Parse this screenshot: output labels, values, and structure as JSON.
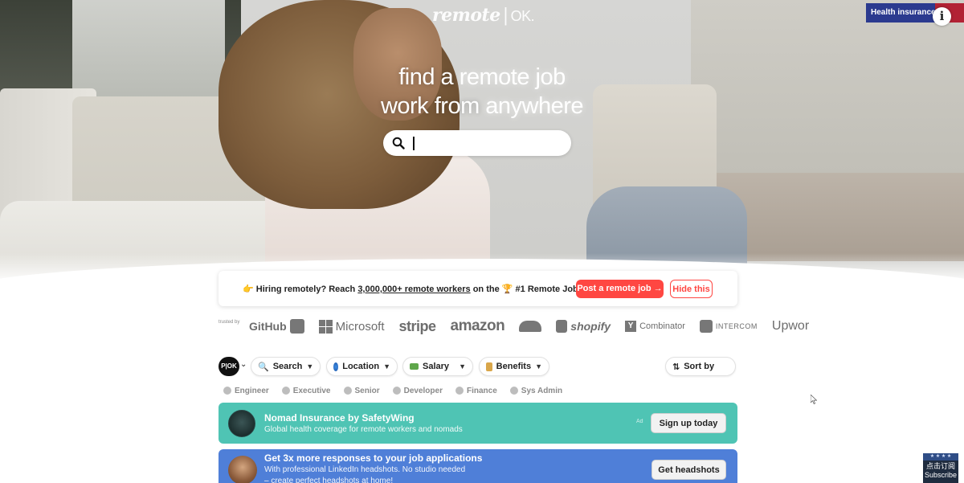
{
  "header": {
    "logo_main": "remote",
    "logo_sep": "|",
    "logo_ok": "OK.",
    "promo_badge": "Health insurance",
    "info_icon": "info-icon"
  },
  "hero": {
    "line1_a": "find a ",
    "line1_b": "remote job",
    "line2_a": "work from ",
    "line2_b": "anywhere",
    "search_value": "",
    "search_icon": "search-icon"
  },
  "hiring_banner": {
    "emoji": "👉",
    "text_before": "Hiring remotely? Reach ",
    "text_link": "3,000,000+ remote workers",
    "text_middle": " on the ",
    "trophy": "🏆",
    "text_after": " #1 Remote Job Board",
    "post_button": "Post a remote job →",
    "hide_button": "Hide this"
  },
  "trusted": {
    "label": "trusted by",
    "brands": [
      "GitHub",
      "Microsoft",
      "stripe",
      "amazon",
      "CLOUDFLARE",
      "shopify",
      "Combinator",
      "INTERCOM",
      "Upwor"
    ]
  },
  "filters": {
    "badge": "P|OK",
    "search": "Search",
    "location": "Location",
    "salary": "Salary",
    "benefits": "Benefits",
    "sort": "Sort by"
  },
  "categories": [
    "Engineer",
    "Executive",
    "Senior",
    "Developer",
    "Finance",
    "Sys Admin"
  ],
  "ads": {
    "nomad": {
      "title": "Nomad Insurance by SafetyWing",
      "subtitle": "Global health coverage for remote workers and nomads",
      "tag": "Ad",
      "cta": "Sign up today"
    },
    "headshots": {
      "title": "Get 3x more responses to your job applications",
      "subtitle": "With professional LinkedIn headshots. No studio needed",
      "subtitle2": "– create perfect headshots at home!",
      "cta": "Get headshots"
    }
  },
  "overlay": {
    "subscribe_top": "点击订阅",
    "subscribe_bottom": "Subscribe"
  },
  "colors": {
    "accent_red": "#ff4742",
    "teal_card": "#4fc4b4",
    "blue_card": "#4f7fd8"
  }
}
